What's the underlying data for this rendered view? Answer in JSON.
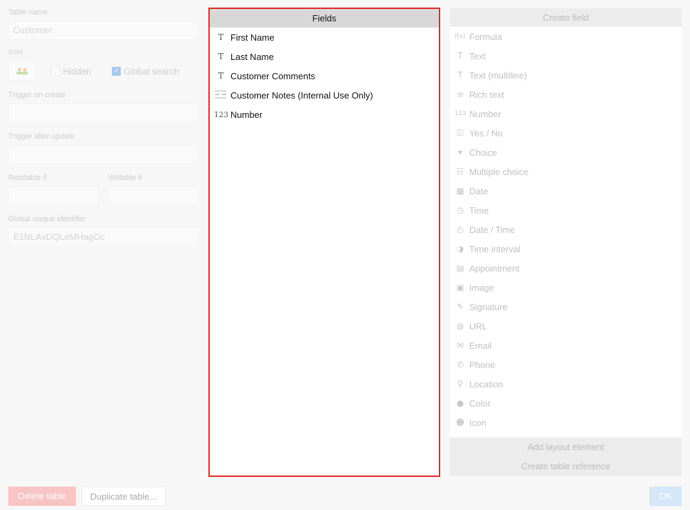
{
  "left": {
    "table_name_label": "Table name",
    "table_name_value": "Customer",
    "icon_label": "Icon",
    "hidden_label": "Hidden",
    "global_search_label": "Global search",
    "trigger_create_label": "Trigger on create",
    "trigger_update_label": "Trigger after update",
    "readable_if_label": "Readable if",
    "writable_if_label": "Writable if",
    "guid_label": "Global unique identifier",
    "guid_value": "E1NLAxDQLeMHagOc"
  },
  "fields": {
    "header": "Fields",
    "items": [
      {
        "icon": "T",
        "label": "First Name"
      },
      {
        "icon": "T",
        "label": "Last Name"
      },
      {
        "icon": "T",
        "label": "Customer Comments"
      },
      {
        "icon": "rich-text-icon",
        "label": "Customer Notes (Internal Use Only)"
      },
      {
        "icon": "123",
        "label": "Number"
      }
    ]
  },
  "create": {
    "header": "Create field",
    "items": [
      {
        "glyph": "f(x)",
        "label": "Formula"
      },
      {
        "glyph": "T",
        "label": "Text"
      },
      {
        "glyph": "T",
        "label": "Text (multiline)"
      },
      {
        "glyph": "≡",
        "label": "Rich text"
      },
      {
        "glyph": "123",
        "label": "Number"
      },
      {
        "glyph": "☑",
        "label": "Yes / No"
      },
      {
        "glyph": "▾",
        "label": "Choice"
      },
      {
        "glyph": "☷",
        "label": "Multiple choice"
      },
      {
        "glyph": "▦",
        "label": "Date"
      },
      {
        "glyph": "◷",
        "label": "Time"
      },
      {
        "glyph": "◴",
        "label": "Date / Time"
      },
      {
        "glyph": "◑",
        "label": "Time interval"
      },
      {
        "glyph": "▤",
        "label": "Appointment"
      },
      {
        "glyph": "▣",
        "label": "Image"
      },
      {
        "glyph": "✎",
        "label": "Signature"
      },
      {
        "glyph": "◍",
        "label": "URL"
      },
      {
        "glyph": "✉",
        "label": "Email"
      },
      {
        "glyph": "✆",
        "label": "Phone"
      },
      {
        "glyph": "⚲",
        "label": "Location"
      },
      {
        "glyph": "●",
        "label": "Color"
      },
      {
        "glyph": "☻",
        "label": "Icon"
      }
    ],
    "add_layout_label": "Add layout element",
    "create_reference_label": "Create table reference"
  },
  "buttons": {
    "delete": "Delete table",
    "duplicate": "Duplicate table...",
    "ok": "OK"
  },
  "colors": {
    "highlight_border": "#e8261f",
    "checkbox_accent": "#4a90e2"
  }
}
